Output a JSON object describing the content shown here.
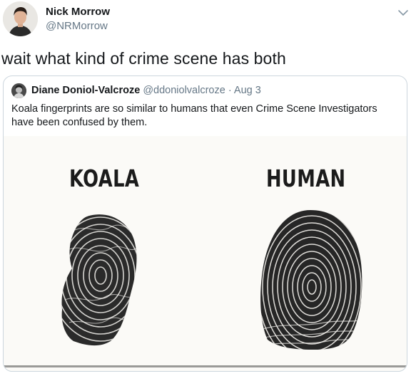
{
  "tweet": {
    "author_name": "Nick Morrow",
    "author_handle": "@NRMorrow",
    "text": "wait what kind of crime scene has both",
    "menu_icon": "chevron-down-icon"
  },
  "quoted": {
    "author_name": "Diane Doniol-Valcroze",
    "author_handle": "@ddoniolvalcroze",
    "separator": "·",
    "date": "Aug 3",
    "text": "Koala fingerprints are so similar to humans that even Crime Scene Investigators have been confused by them.",
    "image": {
      "left_label": "KOALA",
      "right_label": "HUMAN"
    }
  },
  "colors": {
    "text": "#14171a",
    "secondary": "#657786",
    "border": "#ccd6dd",
    "ink": "#1b1b1b"
  }
}
